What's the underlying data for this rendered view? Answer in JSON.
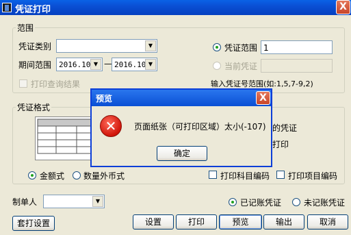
{
  "window": {
    "title": "凭证打印",
    "close_glyph": "X"
  },
  "range_group": {
    "legend": "范围",
    "voucher_type_label": "凭证类别",
    "voucher_type_value": "",
    "period_label": "期间范围",
    "period_from": "2016.10",
    "period_to": "2016.10",
    "period_sep": "—",
    "print_query_label": "打印查询结果",
    "voucher_range_label": "凭证范围",
    "voucher_range_value": "1",
    "current_voucher_label": "当前凭证",
    "current_voucher_value": "",
    "hint": "输入凭证号范围(如:1,5,7-9,2)"
  },
  "format_group": {
    "legend": "凭证格式",
    "amount_format_label": "金额式",
    "quantity_format_label": "数量外币式",
    "print_account_code_label": "打印科目编码",
    "print_item_code_label": "打印项目编码",
    "partial_text_1": "的凭证",
    "partial_text_2": "打印"
  },
  "bottom": {
    "maker_label": "制单人",
    "maker_value": "",
    "posted_label": "已记账凭证",
    "unposted_label": "未记账凭证"
  },
  "buttons": {
    "set_print": "套打设置",
    "settings": "设置",
    "print": "打印",
    "preview": "预览",
    "export": "输出",
    "cancel": "取消"
  },
  "dialog": {
    "title": "预览",
    "message": "页面纸张（可打印区域）太小(-107)",
    "ok": "确定",
    "icon_glyph": "✕",
    "close_glyph": "X"
  },
  "icons": {
    "error": "error-icon",
    "app": "app-icon",
    "dropdown": "chevron-down-icon"
  },
  "state": {
    "voucher_range_selected": true,
    "current_voucher_selected": false,
    "amount_format_selected": true,
    "posted_selected": true
  }
}
